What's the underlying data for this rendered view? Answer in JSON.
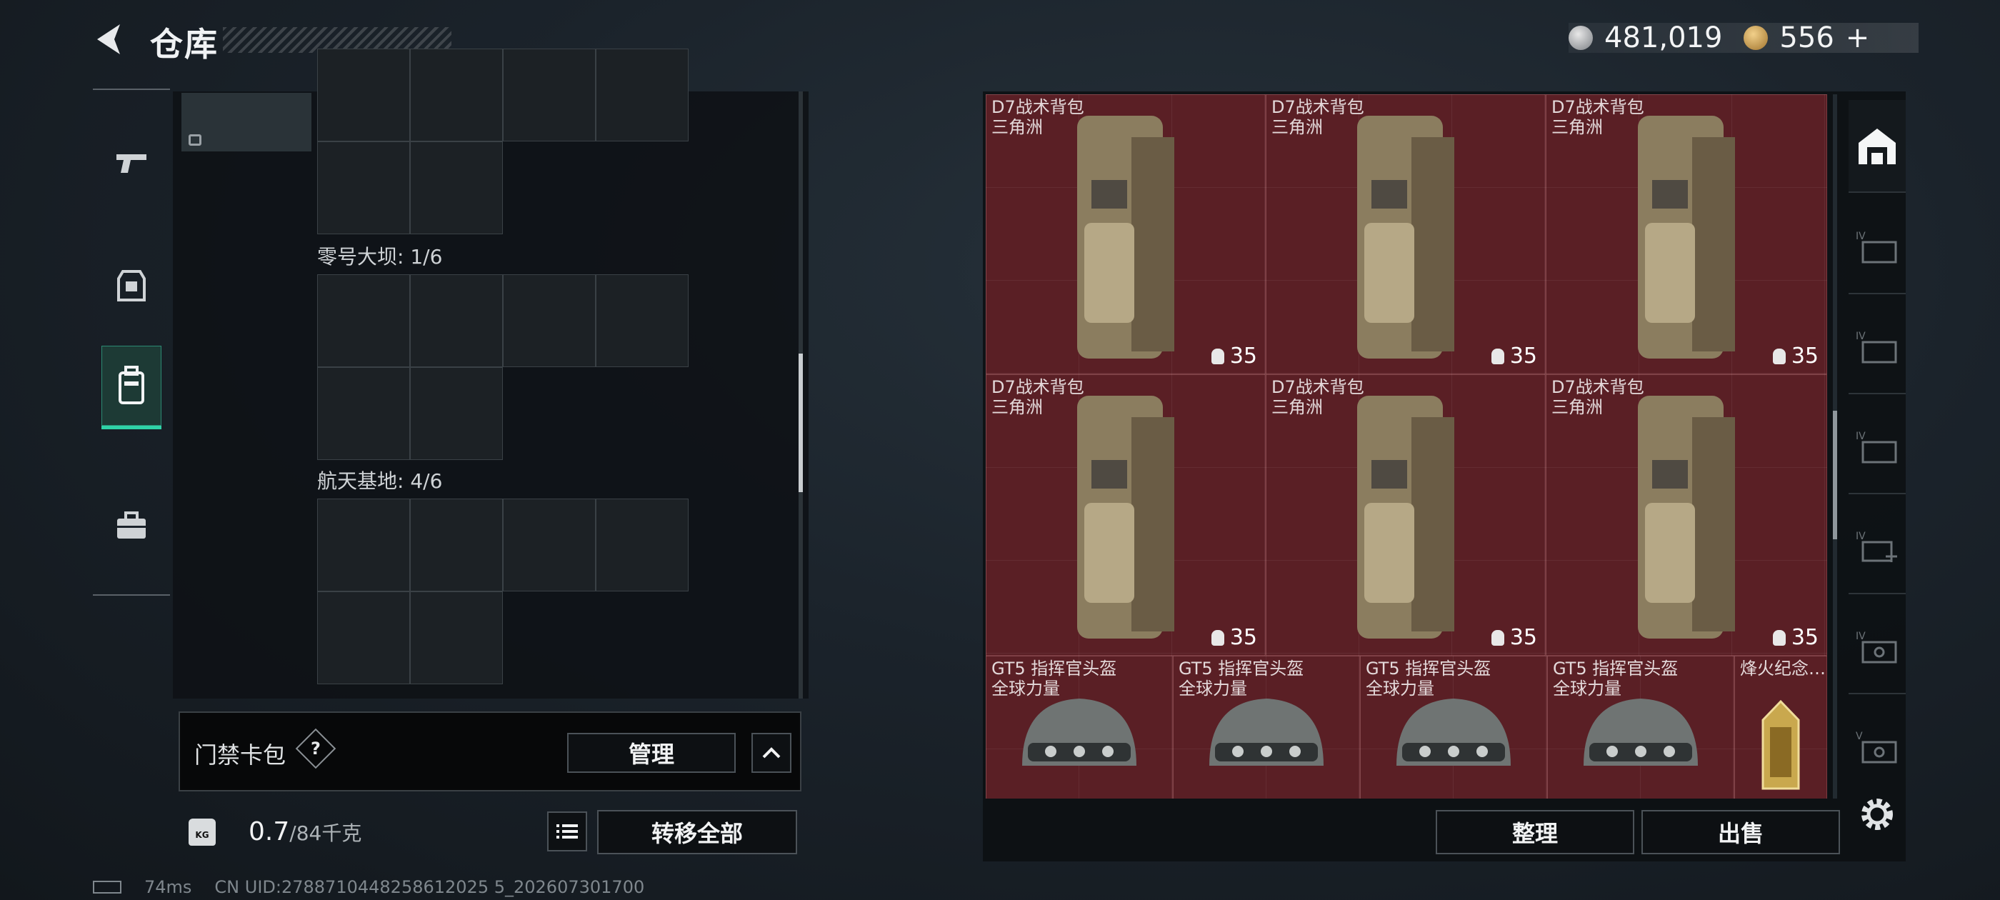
{
  "header": {
    "title": "仓库"
  },
  "currency": {
    "silver": "481,019",
    "gold": "556",
    "gold_plus": "+"
  },
  "left_tabs": [
    "pistol-icon",
    "armor-icon",
    "backpack-icon",
    "toolbox-icon"
  ],
  "storage": {
    "zones": [
      {
        "label": "零号大坝: 1/6"
      },
      {
        "label": "航天基地: 4/6"
      }
    ]
  },
  "keycard": {
    "label": "门禁卡包",
    "help": "?",
    "manage": "管理"
  },
  "weight": {
    "current": "0.7",
    "max_unit": "/84千克",
    "transfer_all": "转移全部"
  },
  "footer": {
    "ping": "74ms",
    "uid": "CN UID:2788710448258612025 5_202607301700"
  },
  "items": {
    "row1": [
      {
        "name": "D7战术背包",
        "sub": "三角洲",
        "cap": "35"
      },
      {
        "name": "D7战术背包",
        "sub": "三角洲",
        "cap": "35"
      },
      {
        "name": "D7战术背包",
        "sub": "三角洲",
        "cap": "35"
      }
    ],
    "row2": [
      {
        "name": "D7战术背包",
        "sub": "三角洲",
        "cap": "35"
      },
      {
        "name": "D7战术背包",
        "sub": "三角洲",
        "cap": "35"
      },
      {
        "name": "D7战术背包",
        "sub": "三角洲",
        "cap": "35"
      }
    ],
    "row3": [
      {
        "name": "GT5 指挥官头盔",
        "sub": "全球力量"
      },
      {
        "name": "GT5 指挥官头盔",
        "sub": "全球力量"
      },
      {
        "name": "GT5 指挥官头盔",
        "sub": "全球力量"
      },
      {
        "name": "GT5 指挥官头盔",
        "sub": "全球力量"
      },
      {
        "name": "烽火纪念…",
        "sub": ""
      }
    ]
  },
  "right_tabs": [
    "warehouse-icon",
    "iv-storage-1-icon",
    "iv-storage-2-icon",
    "iv-storage-3-icon",
    "iv-medical-icon",
    "iv-storage-4-icon",
    "v-storage-icon"
  ],
  "actions": {
    "sort": "整理",
    "sell": "出售"
  },
  "colors": {
    "accent": "#2fd2a7",
    "item_bg": "#5a1f25"
  }
}
